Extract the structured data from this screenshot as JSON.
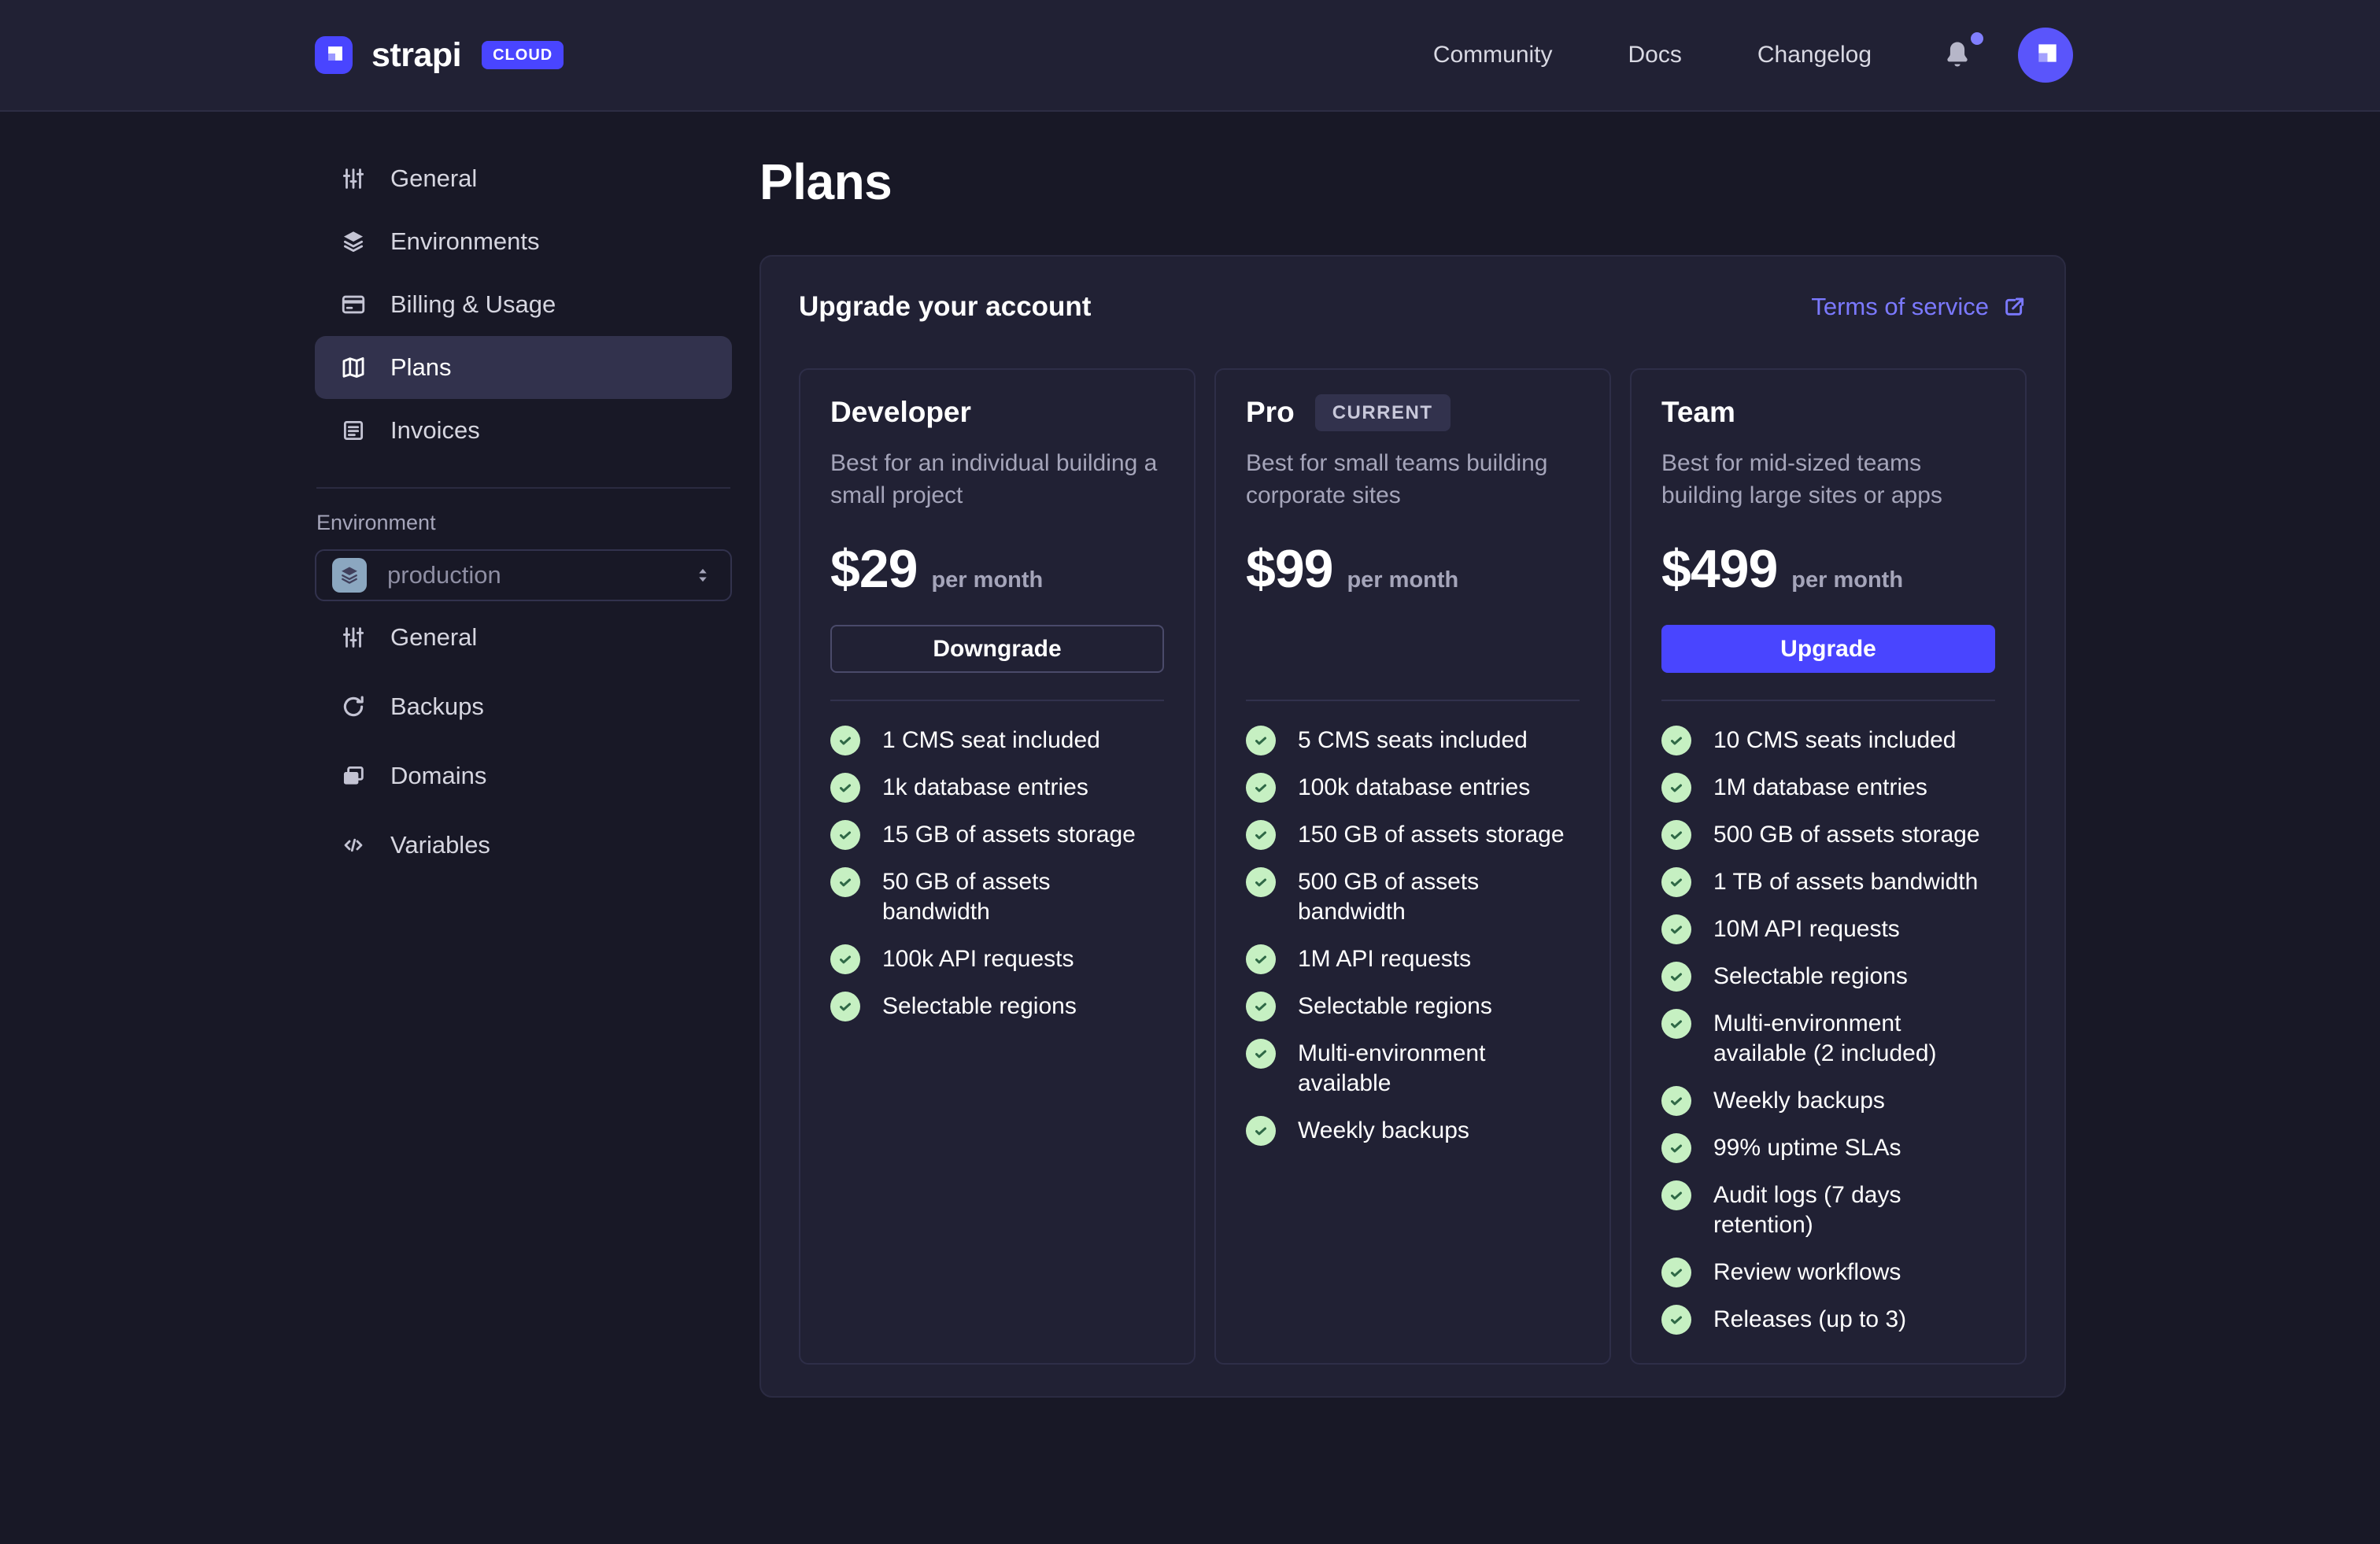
{
  "colors": {
    "accent": "#4945ff",
    "link": "#7b79ff",
    "header_bg": "#212134",
    "page_bg": "#181826",
    "success_circle": "#c6f0c2",
    "success_check": "#2f6846"
  },
  "header": {
    "brand": {
      "name": "strapi",
      "badge": "CLOUD",
      "logo_icon": "strapi-logo-icon"
    },
    "nav": [
      {
        "label": "Community"
      },
      {
        "label": "Docs"
      },
      {
        "label": "Changelog"
      }
    ],
    "notifications_icon": "bell-icon",
    "has_notification_dot": true,
    "avatar_icon": "strapi-avatar-icon"
  },
  "sidebar": {
    "project_nav": [
      {
        "label": "General",
        "icon": "sliders-icon",
        "active": false
      },
      {
        "label": "Environments",
        "icon": "layers-icon",
        "active": false
      },
      {
        "label": "Billing & Usage",
        "icon": "credit-card-icon",
        "active": false
      },
      {
        "label": "Plans",
        "icon": "map-icon",
        "active": true
      },
      {
        "label": "Invoices",
        "icon": "invoice-icon",
        "active": false
      }
    ],
    "environment_section": {
      "label": "Environment",
      "select": {
        "value": "production",
        "icon": "layers-icon",
        "chevron_icon": "chevron-up-down-icon"
      }
    },
    "environment_nav": [
      {
        "label": "General",
        "icon": "sliders-icon"
      },
      {
        "label": "Backups",
        "icon": "refresh-icon"
      },
      {
        "label": "Domains",
        "icon": "folder-icon"
      },
      {
        "label": "Variables",
        "icon": "code-icon"
      }
    ]
  },
  "main": {
    "page_title": "Plans",
    "panel": {
      "title": "Upgrade your account",
      "terms_link": {
        "label": "Terms of service",
        "icon": "external-link-icon"
      },
      "plans": [
        {
          "name": "Developer",
          "badge": null,
          "description": "Best for an individual building a small project",
          "price": "$29",
          "period": "per month",
          "cta": {
            "label": "Downgrade",
            "variant": "outline"
          },
          "features": [
            "1 CMS seat included",
            "1k database entries",
            "15 GB of assets storage",
            "50 GB of assets bandwidth",
            "100k API requests",
            "Selectable regions"
          ]
        },
        {
          "name": "Pro",
          "badge": "CURRENT",
          "description": "Best for small teams building corporate sites",
          "price": "$99",
          "period": "per month",
          "cta": null,
          "features": [
            "5 CMS seats included",
            "100k database entries",
            "150 GB of assets storage",
            "500 GB of assets bandwidth",
            "1M API requests",
            "Selectable regions",
            "Multi-environment available",
            "Weekly backups"
          ]
        },
        {
          "name": "Team",
          "badge": null,
          "description": "Best for mid-sized teams building large sites or apps",
          "price": "$499",
          "period": "per month",
          "cta": {
            "label": "Upgrade",
            "variant": "primary"
          },
          "features": [
            "10 CMS seats included",
            "1M database entries",
            "500 GB of assets storage",
            "1 TB of assets bandwidth",
            "10M API requests",
            "Selectable regions",
            "Multi-environment available (2 included)",
            "Weekly backups",
            "99% uptime SLAs",
            "Audit logs (7 days retention)",
            "Review workflows",
            "Releases (up to 3)"
          ]
        }
      ]
    }
  }
}
